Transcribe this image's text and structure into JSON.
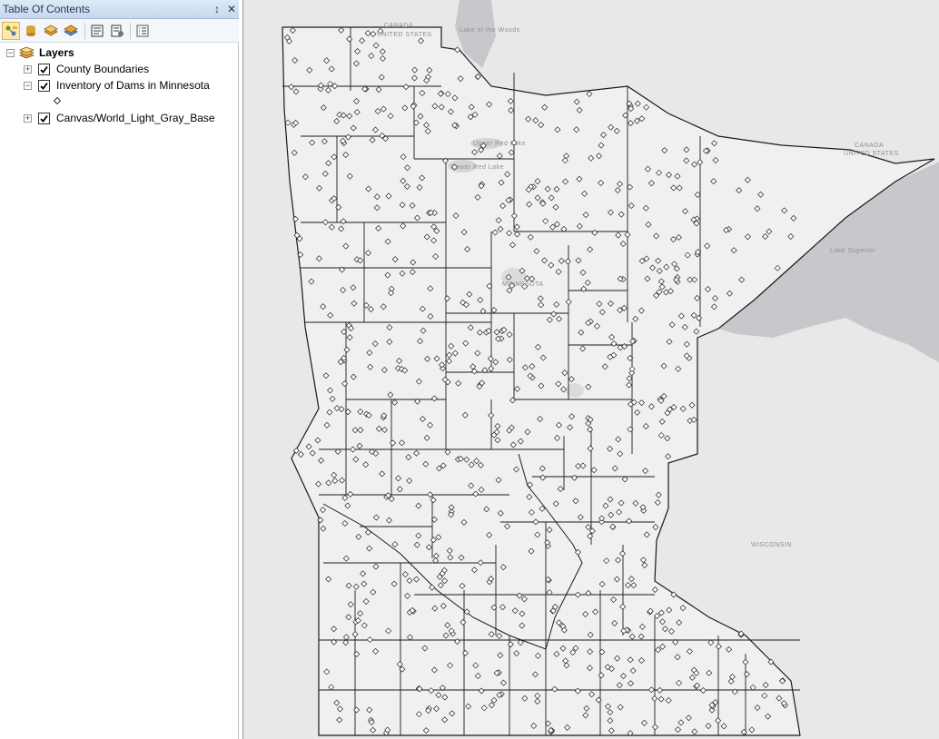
{
  "toc": {
    "title": "Table Of Contents",
    "pin_glyph": "↕",
    "close_glyph": "✕",
    "toolbar": [
      {
        "name": "list-by-drawing-order-button",
        "active": true
      },
      {
        "name": "list-by-source-button",
        "active": false
      },
      {
        "name": "list-by-visibility-button",
        "active": false
      },
      {
        "name": "list-by-selection-button",
        "active": false
      },
      {
        "name": "toc-options-button",
        "active": false
      },
      {
        "name": "toc-settings-button",
        "active": false
      },
      {
        "name": "toc-list-button",
        "active": false
      }
    ],
    "root": {
      "label": "Layers",
      "expand_glyph": "−"
    },
    "layers": [
      {
        "label": "County Boundaries",
        "checked": true,
        "expanded": false,
        "expand_glyph": "+"
      },
      {
        "label": "Inventory of Dams in Minnesota",
        "checked": true,
        "expanded": true,
        "expand_glyph": "−"
      },
      {
        "label": "Canvas/World_Light_Gray_Base",
        "checked": true,
        "expanded": false,
        "expand_glyph": "+"
      }
    ]
  },
  "map": {
    "labels": {
      "canada": "CANADA",
      "united_states_nw": "UNITED STATES",
      "canada_ne": "CANADA",
      "united_states_ne": "UNITED STATES",
      "minnesota": "MINNESOTA",
      "wisconsin": "WISCONSIN",
      "lake_superior": "Lake Superior",
      "lake_of_the_woods": "Lake of the Woods",
      "upper_red_lake": "Upper Red Lake",
      "lower_red_lake": "Lower Red Lake"
    },
    "colors": {
      "background": "#e8e8e8",
      "state_fill": "#f0f0f0",
      "water": "#c8c8cc",
      "county_line": "#1a1a1a",
      "dam_marker": "#222222"
    }
  }
}
